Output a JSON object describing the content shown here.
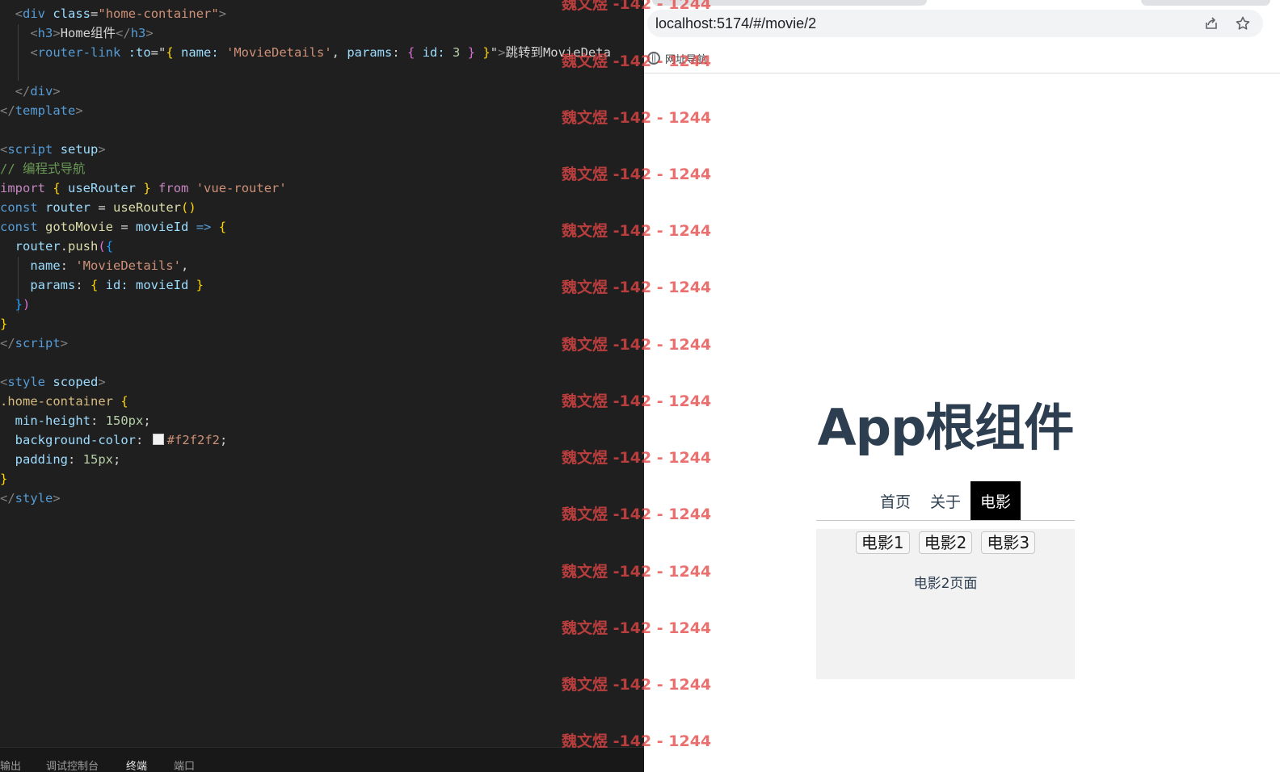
{
  "editor": {
    "lines": [
      [
        [
          "  ",
          "text"
        ],
        [
          "<",
          "punct"
        ],
        [
          "div",
          "tag"
        ],
        [
          " ",
          "text"
        ],
        [
          "class",
          "attr"
        ],
        [
          "=",
          "op"
        ],
        [
          "\"home-container\"",
          "str"
        ],
        [
          ">",
          "punct"
        ]
      ],
      [
        [
          "    ",
          "text"
        ],
        [
          "<",
          "punct"
        ],
        [
          "h3",
          "tag"
        ],
        [
          ">",
          "punct"
        ],
        [
          "Home组件",
          "text"
        ],
        [
          "</",
          "punct"
        ],
        [
          "h3",
          "tag"
        ],
        [
          ">",
          "punct"
        ]
      ],
      [
        [
          "    ",
          "text"
        ],
        [
          "<",
          "punct"
        ],
        [
          "router-link",
          "tag"
        ],
        [
          " ",
          "text"
        ],
        [
          ":to",
          "attr"
        ],
        [
          "=\"",
          "op"
        ],
        [
          "{",
          "b1"
        ],
        [
          " name: ",
          "attr"
        ],
        [
          "'MovieDetails'",
          "str"
        ],
        [
          ", ",
          "text"
        ],
        [
          "params",
          "attr"
        ],
        [
          ": ",
          "text"
        ],
        [
          "{",
          "b2"
        ],
        [
          " id: ",
          "attr"
        ],
        [
          "3",
          "num"
        ],
        [
          " ",
          "text"
        ],
        [
          "}",
          "b2"
        ],
        [
          " ",
          "text"
        ],
        [
          "}",
          "b1"
        ],
        [
          "\"",
          "op"
        ],
        [
          ">",
          "punct"
        ],
        [
          "跳转到MovieDeta",
          "text"
        ]
      ],
      [
        [
          "",
          "text"
        ]
      ],
      [
        [
          "  ",
          "text"
        ],
        [
          "</",
          "punct"
        ],
        [
          "div",
          "tag"
        ],
        [
          ">",
          "punct"
        ]
      ],
      [
        [
          "</",
          "punct"
        ],
        [
          "template",
          "tag"
        ],
        [
          ">",
          "punct"
        ]
      ],
      [
        [
          "",
          "text"
        ]
      ],
      [
        [
          "<",
          "punct"
        ],
        [
          "script",
          "tag"
        ],
        [
          " ",
          "text"
        ],
        [
          "setup",
          "attr"
        ],
        [
          ">",
          "punct"
        ]
      ],
      [
        [
          "// 编程式导航",
          "com"
        ]
      ],
      [
        [
          "import",
          "kw"
        ],
        [
          " ",
          "text"
        ],
        [
          "{",
          "b1"
        ],
        [
          " useRouter ",
          "var"
        ],
        [
          "}",
          "b1"
        ],
        [
          " ",
          "text"
        ],
        [
          "from",
          "kw"
        ],
        [
          " ",
          "text"
        ],
        [
          "'vue-router'",
          "str"
        ]
      ],
      [
        [
          "const",
          "decl"
        ],
        [
          " ",
          "text"
        ],
        [
          "router",
          "var"
        ],
        [
          " = ",
          "op"
        ],
        [
          "useRouter",
          "fn"
        ],
        [
          "()",
          "b1"
        ]
      ],
      [
        [
          "const",
          "decl"
        ],
        [
          " ",
          "text"
        ],
        [
          "gotoMovie",
          "fn"
        ],
        [
          " = ",
          "op"
        ],
        [
          "movieId",
          "var"
        ],
        [
          " ",
          "text"
        ],
        [
          "=>",
          "decl"
        ],
        [
          " ",
          "text"
        ],
        [
          "{",
          "b1"
        ]
      ],
      [
        [
          "  ",
          "text"
        ],
        [
          "router",
          "var"
        ],
        [
          ".",
          "op"
        ],
        [
          "push",
          "fn"
        ],
        [
          "(",
          "b2"
        ],
        [
          "{",
          "b3"
        ]
      ],
      [
        [
          "    ",
          "text"
        ],
        [
          "name",
          "var"
        ],
        [
          ": ",
          "op"
        ],
        [
          "'MovieDetails'",
          "str"
        ],
        [
          ",",
          "op"
        ]
      ],
      [
        [
          "    ",
          "text"
        ],
        [
          "params",
          "var"
        ],
        [
          ": ",
          "op"
        ],
        [
          "{",
          "b1"
        ],
        [
          " id: movieId ",
          "var"
        ],
        [
          "}",
          "b1"
        ]
      ],
      [
        [
          "  ",
          "text"
        ],
        [
          "}",
          "b3"
        ],
        [
          ")",
          "b2"
        ]
      ],
      [
        [
          "}",
          "b1"
        ]
      ],
      [
        [
          "</",
          "punct"
        ],
        [
          "script",
          "tag"
        ],
        [
          ">",
          "punct"
        ]
      ],
      [
        [
          "",
          "text"
        ]
      ],
      [
        [
          "<",
          "punct"
        ],
        [
          "style",
          "tag"
        ],
        [
          " ",
          "text"
        ],
        [
          "scoped",
          "attr"
        ],
        [
          ">",
          "punct"
        ]
      ],
      [
        [
          ".home-container",
          "sel"
        ],
        [
          " ",
          "text"
        ],
        [
          "{",
          "b1"
        ]
      ],
      [
        [
          "  ",
          "text"
        ],
        [
          "min-height",
          "prop"
        ],
        [
          ": ",
          "op"
        ],
        [
          "150px",
          "num"
        ],
        [
          ";",
          "op"
        ]
      ],
      [
        [
          "  ",
          "text"
        ],
        [
          "background-color",
          "prop"
        ],
        [
          ": ",
          "op"
        ],
        [
          "",
          "swatch"
        ],
        [
          "#f2f2f2",
          "str"
        ],
        [
          ";",
          "op"
        ]
      ],
      [
        [
          "  ",
          "text"
        ],
        [
          "padding",
          "prop"
        ],
        [
          ": ",
          "op"
        ],
        [
          "15px",
          "num"
        ],
        [
          ";",
          "op"
        ]
      ],
      [
        [
          "}",
          "b1"
        ]
      ],
      [
        [
          "</",
          "punct"
        ],
        [
          "style",
          "tag"
        ],
        [
          ">",
          "punct"
        ]
      ]
    ]
  },
  "panel_tabs": [
    {
      "label": "输出",
      "active": false
    },
    {
      "label": "调试控制台",
      "active": false
    },
    {
      "label": "终端",
      "active": true
    },
    {
      "label": "端口",
      "active": false
    }
  ],
  "browser": {
    "url": "localhost:5174/#/movie/2",
    "share_icon": "share-icon",
    "star_icon": "star-icon",
    "bookmark": {
      "icon": "globe-icon",
      "label": "网址导航"
    }
  },
  "app": {
    "title": "App根组件",
    "nav": [
      {
        "label": "首页",
        "active": false
      },
      {
        "label": "关于",
        "active": false
      },
      {
        "label": "电影",
        "active": true
      }
    ],
    "movie_buttons": [
      "电影1",
      "电影2",
      "电影3"
    ],
    "page_text": "电影2页面"
  },
  "watermark": "魏文煜 -142 - 1244",
  "colors": {
    "editor_bg": "#1f1f1f",
    "app_title": "#2c3e50",
    "active_nav_bg": "#000000",
    "panel_bg": "#f2f2f2",
    "watermark": "#e44646"
  }
}
